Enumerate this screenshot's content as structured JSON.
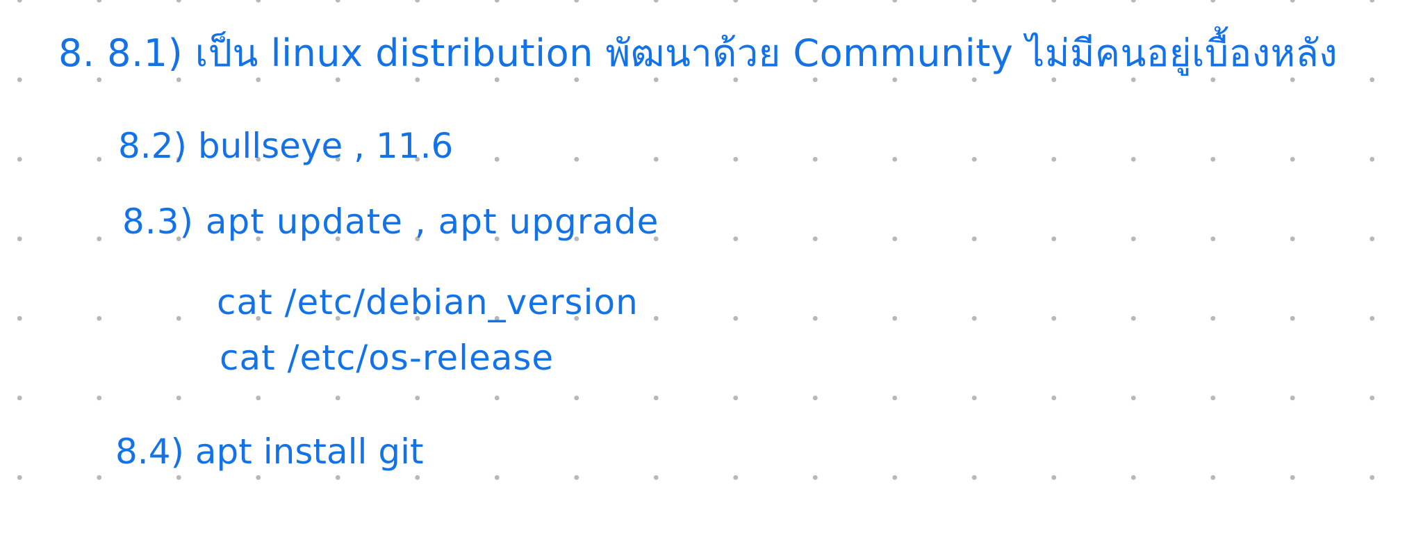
{
  "note": {
    "line_1": "8. 8.1) เป็น linux distribution พัฒนาด้วย Community ไม่มีคนอยู่เบื้องหลัง",
    "line_2": "8.2) bullseye , 11.6",
    "line_3": "8.3) apt update , apt upgrade",
    "line_4": "cat /etc/debian_version",
    "line_5": "cat /etc/os-release",
    "line_6": "8.4) apt install git"
  },
  "colors": {
    "ink": "#1373e6",
    "dots": "#b8b8b8",
    "paper": "#ffffff"
  }
}
